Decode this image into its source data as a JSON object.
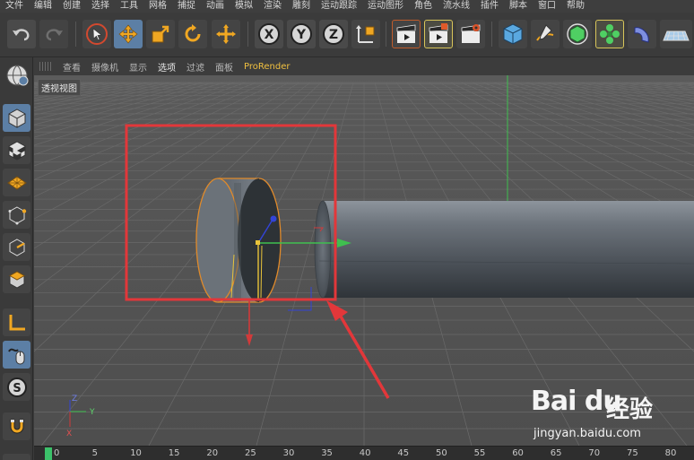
{
  "menu": [
    "文件",
    "编辑",
    "创建",
    "选择",
    "工具",
    "网格",
    "捕捉",
    "动画",
    "模拟",
    "渲染",
    "雕刻",
    "运动跟踪",
    "运动图形",
    "角色",
    "流水线",
    "插件",
    "脚本",
    "窗口",
    "帮助"
  ],
  "toolbar": {
    "undo_icon": "undo-icon",
    "redo_icon": "redo-icon",
    "axis_x": "X",
    "axis_y": "Y",
    "axis_z": "Z"
  },
  "viewport_menu": [
    "查看",
    "摄像机",
    "显示",
    "选项",
    "过滤",
    "面板",
    "ProRender"
  ],
  "viewport": {
    "label": "透视视图"
  },
  "axis_gizmo": {
    "z": "Z",
    "y": "Y",
    "x": "X"
  },
  "timeline": {
    "ticks": [
      "0",
      "5",
      "10",
      "15",
      "20",
      "25",
      "30",
      "35",
      "40",
      "45",
      "50",
      "55",
      "60",
      "65",
      "70",
      "75",
      "80"
    ]
  },
  "watermark": {
    "logo": "Bai du",
    "cn": "经验",
    "url": "jingyan.baidu.com"
  },
  "colors": {
    "accent_active": "#5c7fa5",
    "selection_orange": "#e08a2a",
    "highlight_box": "#e2373a",
    "timeline_marker": "#3bc16a"
  }
}
